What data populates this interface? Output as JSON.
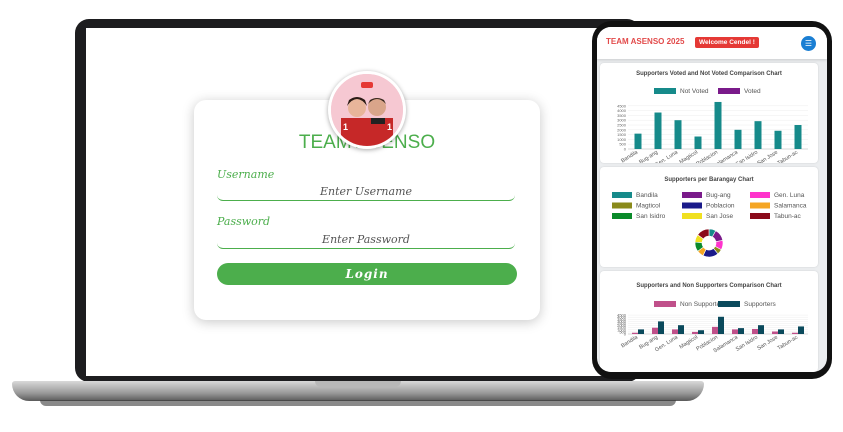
{
  "login": {
    "title": "TEAM ASENSO",
    "username_label": "Username",
    "username_placeholder": "Enter Username",
    "password_label": "Password",
    "password_placeholder": "Enter Password",
    "login_label": "Login"
  },
  "phone_header": {
    "brand": "TEAM ASENSO 2025",
    "welcome": "Welcome Cendel !",
    "menu_icon": "hamburger-icon"
  },
  "colors": {
    "accent_green": "#4cae4c",
    "brand_red": "#e24a4a",
    "menu_blue": "#1b7fd3"
  },
  "chart_data": [
    {
      "type": "bar",
      "title": "Supporters Voted and Not Voted Comparison Chart",
      "categories": [
        "Bandila",
        "Bug-ang",
        "Gen. Luna",
        "Magticol",
        "Poblacion",
        "Salamanca",
        "San Isidro",
        "San Jose",
        "Tabun-ac"
      ],
      "series": [
        {
          "name": "Not Voted",
          "color": "#168a8a",
          "values": [
            1600,
            3800,
            3000,
            1300,
            4900,
            2000,
            2900,
            1900,
            2500
          ]
        },
        {
          "name": "Voted",
          "color": "#7a1a8a",
          "values": [
            0,
            0,
            0,
            0,
            0,
            0,
            0,
            0,
            0
          ]
        }
      ],
      "yticks": [
        "0",
        "500",
        "1000",
        "1500",
        "2000",
        "2500",
        "3000",
        "3500",
        "4000",
        "4500"
      ],
      "ylim": [
        0,
        5000
      ],
      "legend": "top"
    },
    {
      "type": "pie",
      "title": "Supporters per Barangay Chart",
      "labels": [
        "Bandila",
        "Bug-ang",
        "Gen. Luna",
        "Magticol",
        "Poblacion",
        "Salamanca",
        "San Isidro",
        "San Jose",
        "Tabun-ac"
      ],
      "colors": [
        "#168a8a",
        "#7a1a8a",
        "#ff33cc",
        "#8a8a1a",
        "#1a1a8a",
        "#f5a623",
        "#0a8a2a",
        "#f0e020",
        "#8a0a1a"
      ],
      "values": [
        8,
        14,
        11,
        6,
        18,
        8,
        11,
        9,
        15
      ],
      "legend": "top"
    },
    {
      "type": "bar",
      "title": "Supporters and Non Supporters Comparison Chart",
      "categories": [
        "Bandila",
        "Bug-ang",
        "Gen. Luna",
        "Magticol",
        "Poblacion",
        "Salamanca",
        "San Isidro",
        "San Jose",
        "Tabun-ac"
      ],
      "series": [
        {
          "name": "Non Supporters",
          "color": "#c0508a",
          "values": [
            300,
            1500,
            1100,
            500,
            1700,
            1100,
            1200,
            600,
            300
          ]
        },
        {
          "name": "Supporters",
          "color": "#0b4a5c",
          "values": [
            1100,
            3000,
            2100,
            900,
            4100,
            1400,
            2100,
            1100,
            1800
          ]
        }
      ],
      "yticks": [
        "0",
        "500",
        "1000",
        "1500",
        "2000",
        "2500",
        "3000",
        "3500",
        "4000",
        "4500"
      ],
      "ylim": [
        0,
        5000
      ],
      "legend": "top"
    }
  ]
}
